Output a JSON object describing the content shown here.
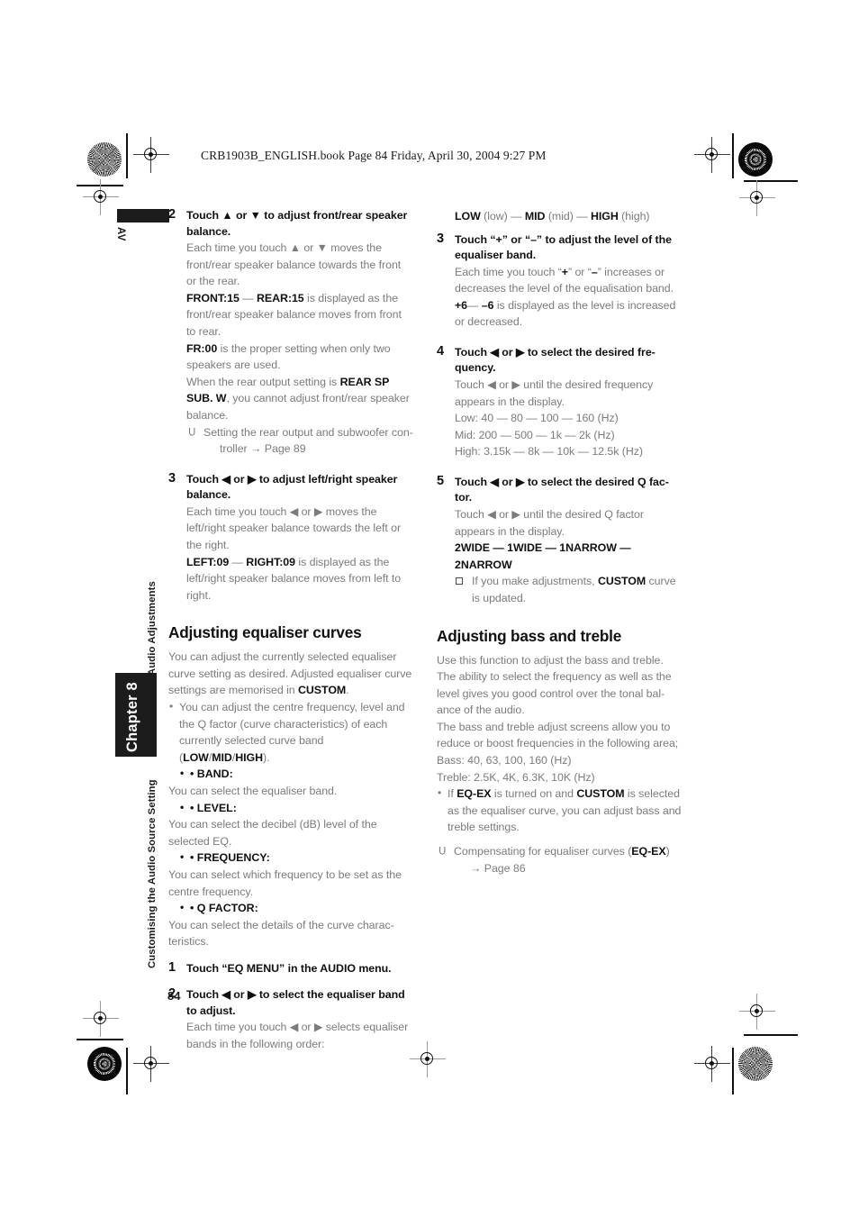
{
  "header": {
    "book_line": "CRB1903B_ENGLISH.book  Page 84  Friday, April 30, 2004  9:27 PM"
  },
  "sidebar": {
    "av_label": "AV",
    "section_label": "Audio Adjustments",
    "chapter_label": "Chapter 8",
    "running_title": "Customising the Audio Source Setting",
    "page_number": "84"
  },
  "left_column": {
    "step2": {
      "num": "2",
      "title": "Touch ▲ or ▼ to adjust front/rear speaker balance.",
      "p1": "Each time you touch ▲ or ▼ moves the front/rear speaker balance towards the front or the rear.",
      "p2_key1": "FRONT:15",
      "p2_dash": " — ",
      "p2_key2": "REAR:15",
      "p2_rest": " is displayed as the front/rear speaker balance moves from front to rear.",
      "p3_key": "FR:00",
      "p3_rest": " is the proper setting when only two speakers are used.",
      "p4_pre": "When the rear output setting is ",
      "p4_key": "REAR SP SUB. W",
      "p4_rest": ", you cannot adjust front/rear speaker balance.",
      "ref": "Setting the rear output and subwoofer con-",
      "ref_cont": "troller → Page 89"
    },
    "step3": {
      "num": "3",
      "title": "Touch ◀ or ▶ to adjust left/right speaker balance.",
      "p1": "Each time you touch ◀ or ▶ moves the left/right speaker balance towards the left or the right.",
      "p2_key1": "LEFT:09",
      "p2_dash": " — ",
      "p2_key2": "RIGHT:09",
      "p2_rest": " is displayed as the left/right speaker balance moves from left to right."
    },
    "section": {
      "heading": "Adjusting equaliser curves",
      "intro_pre": "You can adjust the currently selected equaliser curve setting as desired. Adjusted equaliser curve settings are memorised in ",
      "intro_key": "CUSTOM",
      "intro_post": ".",
      "bullet_pre": "You can adjust the centre frequency, level and the Q factor (curve characteristics) of each currently selected curve band (",
      "bullet_key1": "LOW",
      "bullet_sep1": "/",
      "bullet_key2": "MID",
      "bullet_sep2": "/",
      "bullet_key3": "HIGH",
      "bullet_post": ").",
      "defs": [
        {
          "term": "• BAND:",
          "desc": "You can select the equaliser band."
        },
        {
          "term": "• LEVEL:",
          "desc": "You can select the decibel (dB) level of the selected EQ."
        },
        {
          "term": "• FREQUENCY:",
          "desc": "You can select which frequency to be set as the centre frequency."
        },
        {
          "term": "• Q FACTOR:",
          "desc": "You can select the details of the curve charac-teristics."
        }
      ]
    },
    "step1b": {
      "num": "1",
      "title_pre": "Touch “",
      "title_key1": "EQ MENU",
      "title_mid": "” in the ",
      "title_key2": "AUDIO",
      "title_post": " menu."
    },
    "step2b": {
      "num": "2",
      "title": "Touch ◀ or ▶ to select the equaliser band to adjust.",
      "p1": "Each time you touch ◀ or ▶ selects equaliser bands in the following order:"
    }
  },
  "right_column": {
    "band_order": {
      "k1": "LOW",
      "t1": " (low) — ",
      "k2": "MID",
      "t2": " (mid) — ",
      "k3": "HIGH",
      "t3": " (high)"
    },
    "step3": {
      "num": "3",
      "title": "Touch “+” or “–” to adjust the level of the equaliser band.",
      "p1_pre": "Each time you touch “",
      "p1_k1": "+",
      "p1_mid": "” or “",
      "p1_k2": "–",
      "p1_post": "” increases or decreases the level of the equalisation band.",
      "p2_k1": "+6",
      "p2_dash": "— ",
      "p2_k2": "–6",
      "p2_rest": " is displayed as the level is increased or decreased."
    },
    "step4": {
      "num": "4",
      "title": "Touch ◀ or ▶ to select the desired fre-quency.",
      "p1": "Touch ◀ or ▶ until the desired frequency appears in the display.",
      "freq_low": "Low: 40 — 80 — 100 — 160 (Hz)",
      "freq_mid": "Mid: 200 — 500 — 1k — 2k (Hz)",
      "freq_high": "High: 3.15k — 8k — 10k — 12.5k (Hz)"
    },
    "step5": {
      "num": "5",
      "title": "Touch ◀ or ▶ to select the desired Q fac-tor.",
      "p1": "Touch ◀ or ▶ until the desired Q factor appears in the display.",
      "q_line1": "2WIDE — 1WIDE — 1NARROW —",
      "q_line2": "2NARROW",
      "note_pre": "If you make adjustments, ",
      "note_key": "CUSTOM",
      "note_post": " curve is updated."
    },
    "section": {
      "heading": "Adjusting bass and treble",
      "p1": "Use this function to adjust the bass and treble. The ability to select the frequency as well as the level gives you good control over the tonal bal-ance of the audio.",
      "p2": "The bass and treble adjust screens allow you to reduce or boost frequencies in the following area;",
      "bass": "Bass: 40, 63, 100, 160 (Hz)",
      "treble": "Treble: 2.5K, 4K, 6.3K, 10K (Hz)",
      "bullet_pre": "If ",
      "bullet_k1": "EQ-EX",
      "bullet_mid": " is turned on and ",
      "bullet_k2": "CUSTOM",
      "bullet_post": " is selected as the equaliser curve, you can adjust bass and treble settings.",
      "ref_pre": "Compensating for equaliser curves (",
      "ref_key": "EQ-EX",
      "ref_post": ")",
      "ref_cont": "→ Page 86"
    }
  }
}
